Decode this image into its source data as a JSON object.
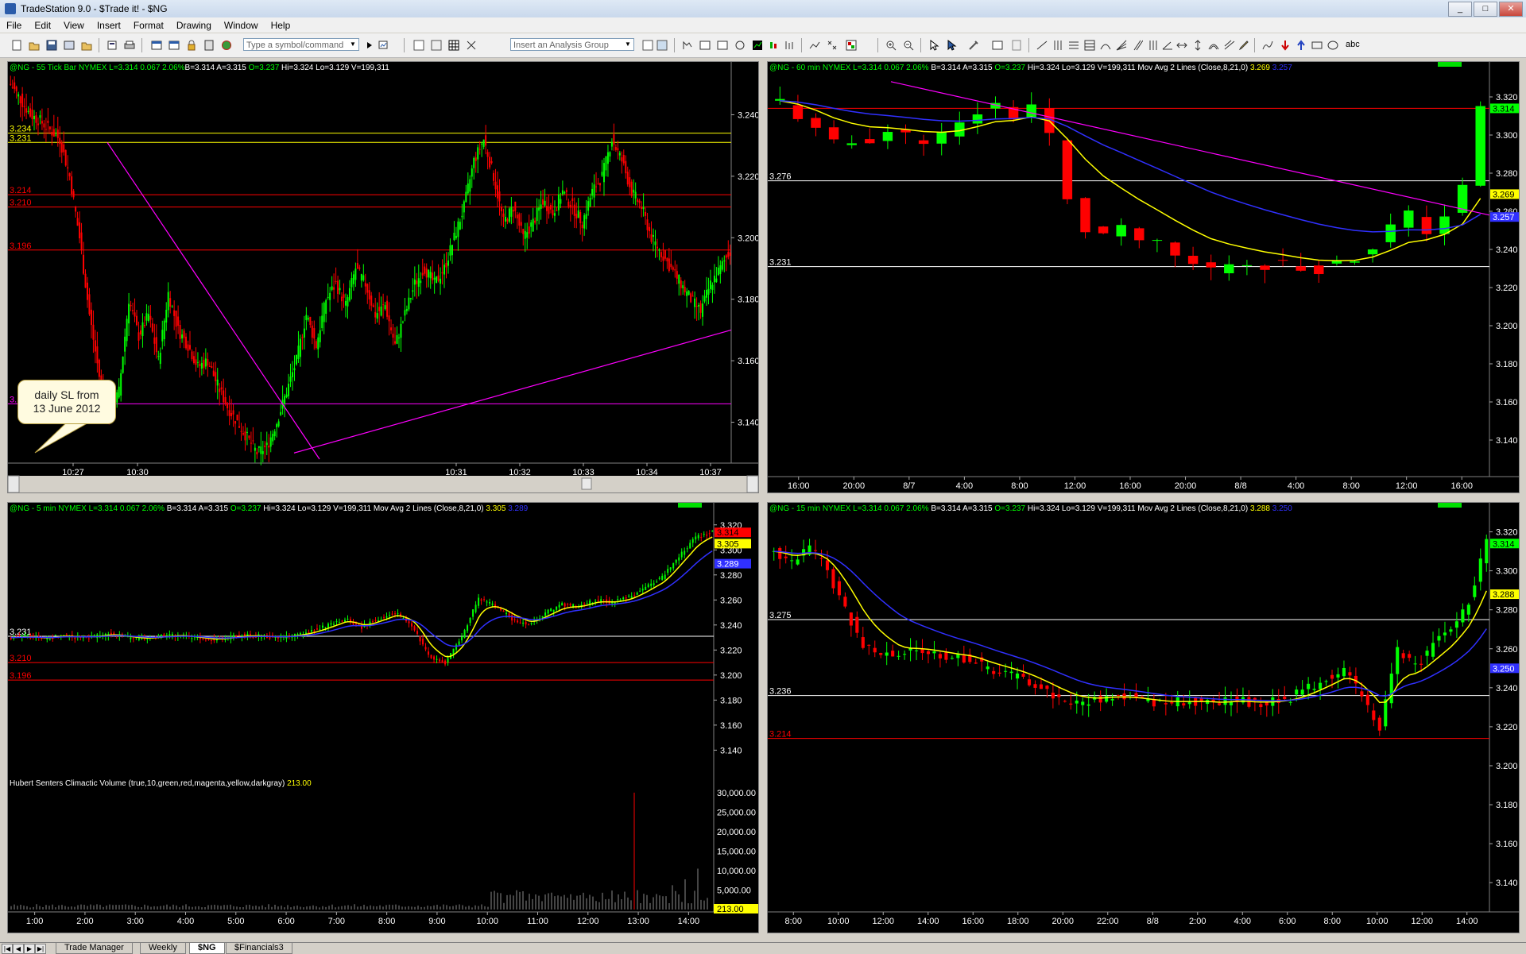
{
  "window": {
    "title": "TradeStation 9.0 - $Trade it! - $NG",
    "buttons": [
      "_",
      "□",
      "✕"
    ]
  },
  "menu": [
    "File",
    "Edit",
    "View",
    "Insert",
    "Format",
    "Drawing",
    "Window",
    "Help"
  ],
  "toolbar": {
    "symbol_placeholder": "Type a symbol/command",
    "analysis_placeholder": "Insert an Analysis Group",
    "abc_label": "abc"
  },
  "tabs": [
    "Trade Manager",
    "Weekly",
    "$NG",
    "$Financials3"
  ],
  "colors": {
    "up": "#00ff00",
    "down": "#ff0000",
    "ma_fast": "#ffff00",
    "ma_slow": "#3030ff",
    "trendline": "#ff00ff",
    "level_white": "#ffffff",
    "level_red": "#ff0000",
    "level_yellow": "#ffff00"
  },
  "panels": {
    "tick": {
      "header": [
        [
          "@NG - 55 Tick Bar  NYMEX  L=3.314  0.067  2.06%",
          "#00ff00"
        ],
        [
          "B=3.314  A=3.315  ",
          "#ffffff"
        ],
        [
          "O=3.237",
          "#00ff00"
        ],
        [
          "  Hi=3.324  Lo=3.129  V=199,311",
          "#ffffff"
        ]
      ],
      "callout": [
        "daily SL from",
        "13 June 2012"
      ]
    },
    "h60": {
      "header": [
        [
          "@NG - 60 min  NYMEX  L=3.314  0.067  2.06%",
          "#00ff00"
        ],
        [
          "  B=3.314  A=3.315  ",
          "#ffffff"
        ],
        [
          "O=3.237",
          "#00ff00"
        ],
        [
          "  Hi=3.324  Lo=3.129  V=199,311  Mov Avg 2 Lines (Close,8,21,0)  ",
          "#ffffff"
        ],
        [
          "3.269",
          "#ffff00"
        ],
        [
          "  3.257",
          "#3030ff"
        ]
      ]
    },
    "m5": {
      "header": [
        [
          "@NG - 5 min  NYMEX  L=3.314  0.067  2.06%",
          "#00ff00"
        ],
        [
          "  B=3.314  A=3.315  ",
          "#ffffff"
        ],
        [
          "O=3.237",
          "#00ff00"
        ],
        [
          "  Hi=3.324  Lo=3.129  V=199,311  Mov Avg 2 Lines (Close,8,21,0)  ",
          "#ffffff"
        ],
        [
          "3.305",
          "#ffff00"
        ],
        [
          "  3.289",
          "#3030ff"
        ]
      ],
      "indicator": [
        [
          "Hubert Senters Climactic Volume (true,10,green,red,magenta,yellow,darkgray)  ",
          "#ffffff"
        ],
        [
          "213.00",
          "#ffff00"
        ]
      ]
    },
    "m15": {
      "header": [
        [
          "@NG - 15 min  NYMEX  L=3.314  0.067  2.06%",
          "#00ff00"
        ],
        [
          "  B=3.314  A=3.315  ",
          "#ffffff"
        ],
        [
          "O=3.237",
          "#00ff00"
        ],
        [
          "  Hi=3.324  Lo=3.129  V=199,311  Mov Avg 2 Lines (Close,8,21,0)  ",
          "#ffffff"
        ],
        [
          "3.288",
          "#ffff00"
        ],
        [
          "  3.250",
          "#3030ff"
        ]
      ]
    }
  },
  "chart_data": [
    {
      "type": "candlestick",
      "name": "@NG - 55 Tick Bar",
      "ylim": [
        3.128,
        3.252
      ],
      "yticks": [
        "3.240",
        "3.220",
        "3.200",
        "3.180",
        "3.160",
        "3.140"
      ],
      "xticks": [
        "10:27",
        "10:30",
        "10:31",
        "10:32",
        "10:33",
        "10:34",
        "10:37"
      ],
      "levels": [
        {
          "value": 3.234,
          "color": "#ffff00",
          "label": "3.234"
        },
        {
          "value": 3.231,
          "color": "#ffff00",
          "label": "3.231"
        },
        {
          "value": 3.214,
          "color": "#ff0000",
          "label": "3.214"
        },
        {
          "value": 3.21,
          "color": "#ff0000",
          "label": "3.210"
        },
        {
          "value": 3.196,
          "color": "#ff0000",
          "label": "3.196"
        },
        {
          "value": 3.146,
          "color": "#ff00ff",
          "label": "3.146"
        }
      ],
      "path": [
        3.25,
        3.245,
        3.24,
        3.238,
        3.235,
        3.232,
        3.22,
        3.2,
        3.175,
        3.155,
        3.142,
        3.15,
        3.18,
        3.168,
        3.175,
        3.16,
        3.182,
        3.17,
        3.165,
        3.158,
        3.16,
        3.152,
        3.145,
        3.14,
        3.135,
        3.13,
        3.132,
        3.14,
        3.15,
        3.16,
        3.175,
        3.165,
        3.18,
        3.185,
        3.178,
        3.19,
        3.185,
        3.175,
        3.178,
        3.165,
        3.175,
        3.185,
        3.19,
        3.185,
        3.19,
        3.2,
        3.21,
        3.225,
        3.232,
        3.22,
        3.205,
        3.21,
        3.2,
        3.205,
        3.212,
        3.208,
        3.215,
        3.21,
        3.205,
        3.215,
        3.22,
        3.232,
        3.225,
        3.215,
        3.21,
        3.2,
        3.195,
        3.19,
        3.185,
        3.18,
        3.176,
        3.185,
        3.19,
        3.196
      ]
    },
    {
      "type": "candlestick",
      "name": "@NG - 60 min",
      "ylim": [
        3.13,
        3.33
      ],
      "yticks": [
        "3.320",
        "3.300",
        "3.280",
        "3.260",
        "3.240",
        "3.220",
        "3.200",
        "3.180",
        "3.160",
        "3.140"
      ],
      "xticks": [
        "16:00",
        "20:00",
        "8/7",
        "4:00",
        "8:00",
        "12:00",
        "16:00",
        "20:00",
        "8/8",
        "4:00",
        "8:00",
        "12:00",
        "16:00"
      ],
      "levels": [
        {
          "value": 3.276,
          "color": "#ffffff",
          "label": "3.276"
        },
        {
          "value": 3.231,
          "color": "#ffffff",
          "label": "3.231"
        },
        {
          "value": 3.314,
          "color": "#ff0000",
          "label": ""
        }
      ],
      "price_tags": [
        {
          "value": 3.314,
          "text": "3.314",
          "bg": "#00ff00"
        },
        {
          "value": 3.269,
          "text": "3.269",
          "bg": "#ffff00"
        },
        {
          "value": 3.257,
          "text": "3.257",
          "bg": "#3030ff"
        }
      ],
      "path": [
        3.318,
        3.31,
        3.302,
        3.295,
        3.296,
        3.298,
        3.302,
        3.3,
        3.298,
        3.3,
        3.305,
        3.312,
        3.316,
        3.31,
        3.316,
        3.3,
        3.265,
        3.25,
        3.248,
        3.25,
        3.245,
        3.242,
        3.236,
        3.232,
        3.23,
        3.233,
        3.233,
        3.232,
        3.232,
        3.23,
        3.23,
        3.233,
        3.235,
        3.242,
        3.252,
        3.258,
        3.25,
        3.258,
        3.272,
        3.314
      ]
    },
    {
      "type": "candlestick",
      "name": "@NG - 5 min",
      "ylim": [
        3.125,
        3.33
      ],
      "yticks": [
        "3.320",
        "3.300",
        "3.280",
        "3.260",
        "3.240",
        "3.220",
        "3.200",
        "3.180",
        "3.160",
        "3.140"
      ],
      "xticks": [
        "1:00",
        "2:00",
        "3:00",
        "4:00",
        "5:00",
        "6:00",
        "7:00",
        "8:00",
        "9:00",
        "10:00",
        "11:00",
        "12:00",
        "13:00",
        "14:00"
      ],
      "levels": [
        {
          "value": 3.231,
          "color": "#ffffff",
          "label": "3.231"
        },
        {
          "value": 3.21,
          "color": "#ff0000",
          "label": "3.210"
        },
        {
          "value": 3.196,
          "color": "#ff0000",
          "label": "3.196"
        }
      ],
      "price_tags": [
        {
          "value": 3.314,
          "text": "3.314",
          "bg": "#ff0000"
        },
        {
          "value": 3.305,
          "text": "3.305",
          "bg": "#ffff00"
        },
        {
          "value": 3.289,
          "text": "3.289",
          "bg": "#3030ff"
        }
      ],
      "volume": {
        "yticks": [
          "30,000.00",
          "25,000.00",
          "20,000.00",
          "15,000.00",
          "10,000.00",
          "5,000.00"
        ],
        "last": "213.00"
      },
      "path": [
        3.23,
        3.231,
        3.229,
        3.232,
        3.23,
        3.231,
        3.233,
        3.23,
        3.229,
        3.231,
        3.232,
        3.23,
        3.228,
        3.23,
        3.232,
        3.231,
        3.23,
        3.232,
        3.235,
        3.24,
        3.245,
        3.238,
        3.245,
        3.25,
        3.24,
        3.215,
        3.21,
        3.23,
        3.262,
        3.255,
        3.245,
        3.24,
        3.25,
        3.256,
        3.255,
        3.26,
        3.258,
        3.262,
        3.27,
        3.278,
        3.295,
        3.31,
        3.314
      ]
    },
    {
      "type": "candlestick",
      "name": "@NG - 15 min",
      "ylim": [
        3.125,
        3.33
      ],
      "yticks": [
        "3.320",
        "3.300",
        "3.280",
        "3.260",
        "3.240",
        "3.220",
        "3.200",
        "3.180",
        "3.160",
        "3.140"
      ],
      "xticks": [
        "8:00",
        "10:00",
        "12:00",
        "14:00",
        "16:00",
        "18:00",
        "20:00",
        "22:00",
        "8/8",
        "2:00",
        "4:00",
        "6:00",
        "8:00",
        "10:00",
        "12:00",
        "14:00"
      ],
      "levels": [
        {
          "value": 3.275,
          "color": "#ffffff",
          "label": "3.275"
        },
        {
          "value": 3.236,
          "color": "#ffffff",
          "label": "3.236"
        },
        {
          "value": 3.214,
          "color": "#ff0000",
          "label": "3.214"
        }
      ],
      "price_tags": [
        {
          "value": 3.314,
          "text": "3.314",
          "bg": "#00ff00"
        },
        {
          "value": 3.288,
          "text": "3.288",
          "bg": "#ffff00"
        },
        {
          "value": 3.25,
          "text": "3.250",
          "bg": "#3030ff"
        }
      ],
      "path": [
        3.31,
        3.305,
        3.312,
        3.3,
        3.28,
        3.262,
        3.258,
        3.255,
        3.26,
        3.258,
        3.256,
        3.255,
        3.25,
        3.248,
        3.245,
        3.24,
        3.235,
        3.232,
        3.234,
        3.236,
        3.235,
        3.233,
        3.232,
        3.233,
        3.233,
        3.232,
        3.234,
        3.232,
        3.233,
        3.235,
        3.24,
        3.245,
        3.25,
        3.235,
        3.22,
        3.26,
        3.25,
        3.262,
        3.27,
        3.285,
        3.314
      ]
    }
  ]
}
